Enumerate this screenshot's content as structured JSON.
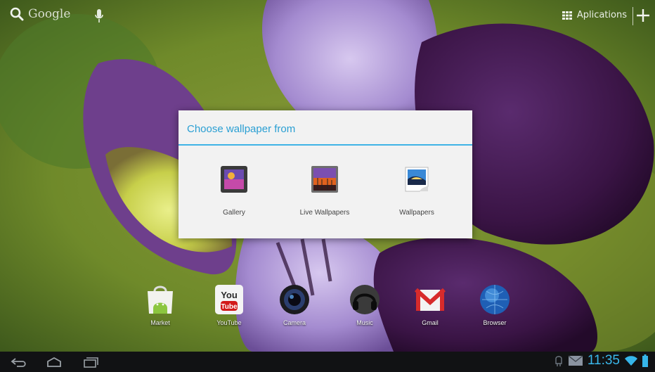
{
  "search": {
    "label": "Google",
    "icon": "search-icon"
  },
  "apps_label": "Aplications",
  "dialog": {
    "title": "Choose wallpaper from",
    "options": [
      {
        "label": "Gallery",
        "icon": "gallery-icon"
      },
      {
        "label": "Live Wallpapers",
        "icon": "live-wallpapers-icon"
      },
      {
        "label": "Wallpapers",
        "icon": "wallpapers-icon"
      }
    ]
  },
  "dock": [
    {
      "label": "Market",
      "icon": "market-icon"
    },
    {
      "label": "YouTube",
      "icon": "youtube-icon",
      "icon_text_top": "You",
      "icon_text_bottom": "Tube"
    },
    {
      "label": "Camera",
      "icon": "camera-icon"
    },
    {
      "label": "Music",
      "icon": "music-icon"
    },
    {
      "label": "Gmail",
      "icon": "gmail-icon"
    },
    {
      "label": "Browser",
      "icon": "browser-icon"
    }
  ],
  "status": {
    "time": "11:35"
  },
  "colors": {
    "accent": "#33b5e5",
    "dialog_bg": "#f2f2f2",
    "navbar_bg": "#111214"
  }
}
